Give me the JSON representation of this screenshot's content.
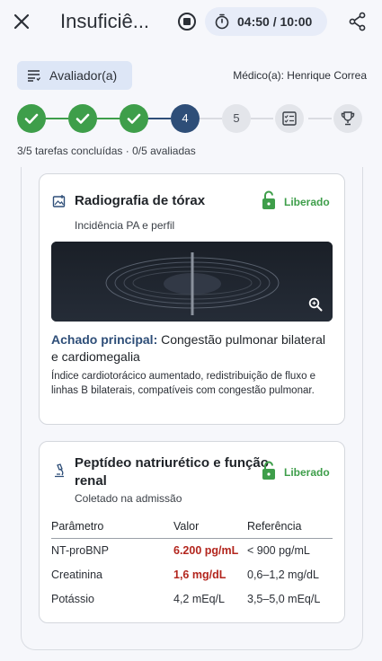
{
  "header": {
    "title": "Insuficiê...",
    "timer": "04:50 / 10:00",
    "icons": {
      "close": "close-icon",
      "stop": "stop-icon",
      "timer": "timer-icon",
      "share": "share-icon"
    }
  },
  "role": {
    "label": "Avaliador(a)"
  },
  "doctor": "Médico(a): Henrique Correa",
  "stepper": {
    "steps": [
      {
        "state": "done"
      },
      {
        "state": "done"
      },
      {
        "state": "done"
      },
      {
        "state": "current",
        "label": "4"
      },
      {
        "state": "todo",
        "label": "5"
      },
      {
        "state": "todo",
        "icon": "checklist-icon"
      },
      {
        "state": "todo",
        "icon": "trophy-icon"
      }
    ]
  },
  "progress": "3/5 tarefas concluídas · 0/5 avaliadas",
  "cards": {
    "xray": {
      "title": "Radiografia de tórax",
      "status": "Liberado",
      "subtitle": "Incidência PA e perfil",
      "finding_label": "Achado principal:",
      "finding_text": " Congestão pulmonar bilateral e cardiomegalia",
      "detail": "Índice cardiotorácico aumentado, redistribuição de fluxo e linhas B bilaterais, compatíveis com congestão pulmonar."
    },
    "labs": {
      "title_line1": "Peptídeo natriurético e função",
      "title_line2": "renal",
      "status": "Liberado",
      "subtitle": "Coletado na admissão",
      "headers": {
        "param": "Parâmetro",
        "value": "Valor",
        "ref": "Referência"
      },
      "rows": [
        {
          "param": "NT-proBNP",
          "value": "6.200 pg/mL",
          "ref": "< 900 pg/mL",
          "abnormal": true
        },
        {
          "param": "Creatinina",
          "value": "1,6 mg/dL",
          "ref": "0,6–1,2 mg/dL",
          "abnormal": true
        },
        {
          "param": "Potássio",
          "value": "4,2 mEq/L",
          "ref": "3,5–5,0 mEq/L",
          "abnormal": false
        }
      ]
    }
  },
  "colors": {
    "success": "#3e9e4a",
    "primary": "#2e4e78",
    "abnormal": "#b3261e"
  }
}
